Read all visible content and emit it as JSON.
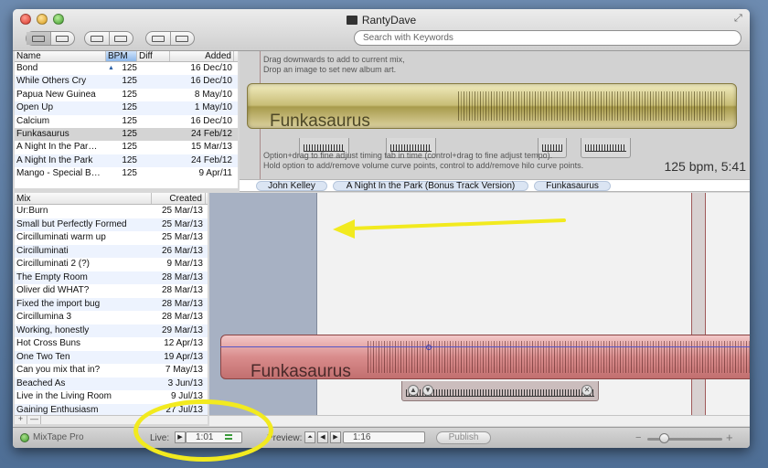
{
  "window": {
    "title": "RantyDave"
  },
  "search": {
    "placeholder": "Search with Keywords"
  },
  "tracks": {
    "columns": [
      "Name",
      "BPM",
      "Diff",
      "Added"
    ],
    "rows": [
      [
        "Bond",
        "125",
        "",
        "16 Dec/10"
      ],
      [
        "While Others Cry",
        "125",
        "",
        "16 Dec/10"
      ],
      [
        "Papua New Guinea",
        "125",
        "",
        "8 May/10"
      ],
      [
        "Open Up",
        "125",
        "",
        "1 May/10"
      ],
      [
        "Calcium",
        "125",
        "",
        "16 Dec/10"
      ],
      [
        "Funkasaurus",
        "125",
        "",
        "24 Feb/12"
      ],
      [
        "A Night In the Par…",
        "125",
        "",
        "15 Mar/13"
      ],
      [
        "A Night In the Park",
        "125",
        "",
        "24 Feb/12"
      ],
      [
        "Mango - Special B…",
        "125",
        "",
        "9 Apr/11"
      ]
    ],
    "selected_index": 5
  },
  "upper": {
    "hint_top_1": "Drag downwards to add to current mix,",
    "hint_top_2": "Drop an image to set new album art.",
    "track_title": "Funkasaurus",
    "hint_bottom_1": "Option+drag to fine adjust timing tab in time (control+drag to fine adjust tempo).",
    "hint_bottom_2": "Hold option to add/remove volume curve points, control to add/remove hilo curve points.",
    "bpm_readout": "125 bpm, 5:41"
  },
  "crumbs": [
    "John Kelley",
    "A Night In the Park (Bonus Track Version)",
    "Funkasaurus"
  ],
  "mixes": {
    "columns": [
      "Mix",
      "Created"
    ],
    "rows": [
      [
        "Ur:Burn",
        "25 Mar/13"
      ],
      [
        "Small but Perfectly Formed",
        "25 Mar/13"
      ],
      [
        "Circilluminati warm up",
        "25 Mar/13"
      ],
      [
        "Circilluminati",
        "26 Mar/13"
      ],
      [
        "Circilluminati 2 (?)",
        "9 Mar/13"
      ],
      [
        "The Empty Room",
        "28 Mar/13"
      ],
      [
        "Oliver did WHAT?",
        "28 Mar/13"
      ],
      [
        "Fixed the import bug",
        "28 Mar/13"
      ],
      [
        "Circillumina 3",
        "28 Mar/13"
      ],
      [
        "Working, honestly",
        "29 Mar/13"
      ],
      [
        "Hot Cross Buns",
        "12 Apr/13"
      ],
      [
        "One Two Ten",
        "19 Apr/13"
      ],
      [
        "Can you mix that in?",
        "7 May/13"
      ],
      [
        "Beached As",
        "3 Jun/13"
      ],
      [
        "Live in the Living Room",
        "9 Jul/13"
      ],
      [
        "Gaining Enthusiasm",
        "27 Jul/13"
      ]
    ],
    "add_label": "+",
    "remove_label": "—"
  },
  "timeline": {
    "clip_title": "Funkasaurus"
  },
  "status": {
    "app_name": "MixTape Pro",
    "live_label": "Live:",
    "live_time": "1:01",
    "preview_label": "Preview:",
    "preview_time": "1:16",
    "publish_label": "Publish",
    "zoom_minus": "−",
    "zoom_plus": "+",
    "zoom_level": 0.22
  },
  "colors": {
    "accent_annotation": "#f2ea1f",
    "track_waveform": "#c8bd76",
    "mix_waveform": "#d98c8c"
  }
}
